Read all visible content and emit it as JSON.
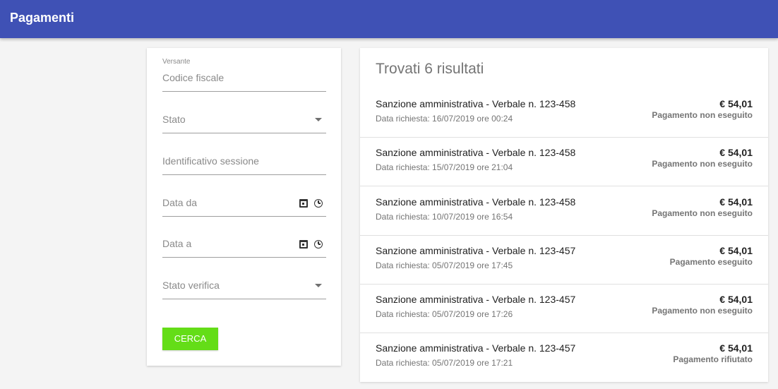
{
  "appbar": {
    "title": "Pagamenti"
  },
  "filters": {
    "versante_label": "Versante",
    "codice_fiscale_placeholder": "Codice fiscale",
    "stato_label": "Stato",
    "identificativo_placeholder": "Identificativo sessione",
    "data_da_label": "Data da",
    "data_a_label": "Data a",
    "stato_verifica_label": "Stato verifica",
    "search_label": "CERCA"
  },
  "results": {
    "title": "Trovati 6 risultati",
    "items": [
      {
        "title": "Sanzione amministrativa - Verbale n. 123-458",
        "date": "Data richiesta: 16/07/2019 ore 00:24",
        "amount": "€ 54,01",
        "status": "Pagamento non eseguito"
      },
      {
        "title": "Sanzione amministrativa - Verbale n. 123-458",
        "date": "Data richiesta: 15/07/2019 ore 21:04",
        "amount": "€ 54,01",
        "status": "Pagamento non eseguito"
      },
      {
        "title": "Sanzione amministrativa - Verbale n. 123-458",
        "date": "Data richiesta: 10/07/2019 ore 16:54",
        "amount": "€ 54,01",
        "status": "Pagamento non eseguito"
      },
      {
        "title": "Sanzione amministrativa - Verbale n. 123-457",
        "date": "Data richiesta: 05/07/2019 ore 17:45",
        "amount": "€ 54,01",
        "status": "Pagamento eseguito"
      },
      {
        "title": "Sanzione amministrativa - Verbale n. 123-457",
        "date": "Data richiesta: 05/07/2019 ore 17:26",
        "amount": "€ 54,01",
        "status": "Pagamento non eseguito"
      },
      {
        "title": "Sanzione amministrativa - Verbale n. 123-457",
        "date": "Data richiesta: 05/07/2019 ore 17:21",
        "amount": "€ 54,01",
        "status": "Pagamento rifiutato"
      }
    ]
  },
  "colors": {
    "appbar": "#3f51b5",
    "search_button": "#64dd17"
  },
  "icons": [
    "dropdown-caret-icon",
    "calendar-icon",
    "clock-icon"
  ]
}
